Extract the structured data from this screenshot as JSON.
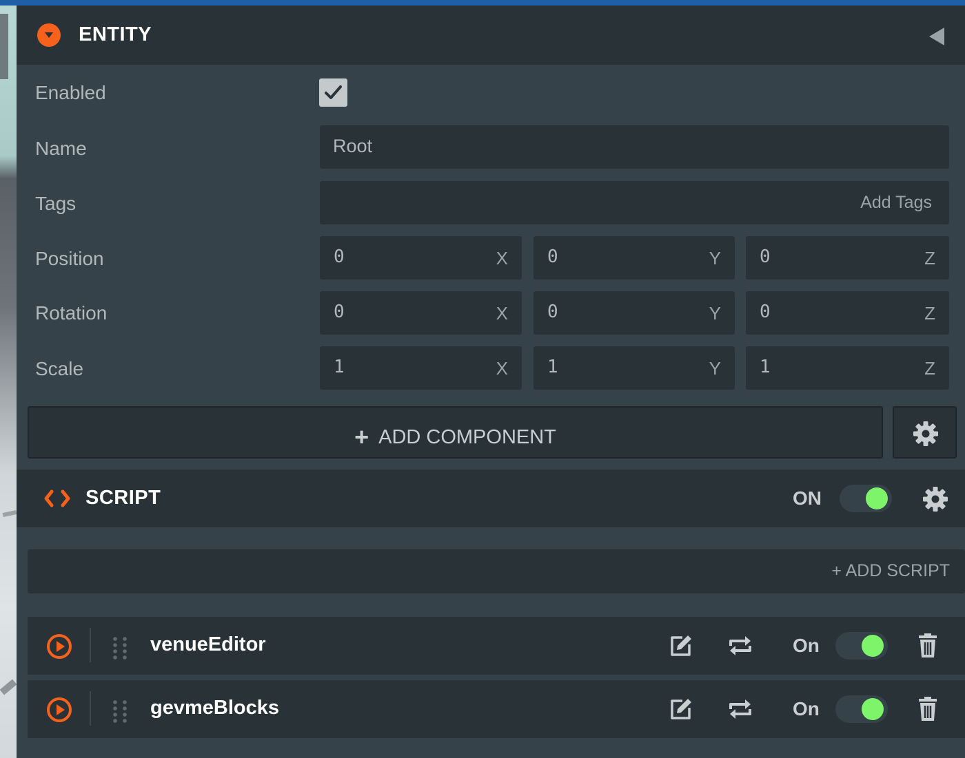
{
  "colors": {
    "accent": "#f6621c",
    "panel_bg": "#364249",
    "header_bg": "#293237",
    "toggle_on": "#7df46a",
    "text_muted": "#b1b8ba"
  },
  "entity": {
    "title": "ENTITY",
    "fields": {
      "enabled_label": "Enabled",
      "enabled": true,
      "name_label": "Name",
      "name_value": "Root",
      "tags_label": "Tags",
      "tags_placeholder": "Add Tags",
      "position_label": "Position",
      "position": {
        "x": "0",
        "y": "0",
        "z": "0"
      },
      "rotation_label": "Rotation",
      "rotation": {
        "x": "0",
        "y": "0",
        "z": "0"
      },
      "scale_label": "Scale",
      "scale": {
        "x": "1",
        "y": "1",
        "z": "1"
      }
    },
    "axis_labels": {
      "x": "X",
      "y": "Y",
      "z": "Z"
    },
    "add_component_label": "ADD COMPONENT"
  },
  "script": {
    "title": "SCRIPT",
    "state_label": "ON",
    "enabled": true,
    "add_script_label": "+ ADD SCRIPT",
    "items": [
      {
        "name": "venueEditor",
        "state_label": "On",
        "enabled": true
      },
      {
        "name": "gevmeBlocks",
        "state_label": "On",
        "enabled": true
      }
    ]
  },
  "icons": {
    "collapse": "chevron-down-circle-icon",
    "back": "triangle-left-icon",
    "check": "checkmark-icon",
    "settings": "gear-icon",
    "code": "code-brackets-icon",
    "play": "play-circle-icon",
    "drag": "drag-handle-icon",
    "edit": "edit-icon",
    "reload": "reload-icon",
    "delete": "trash-icon"
  }
}
